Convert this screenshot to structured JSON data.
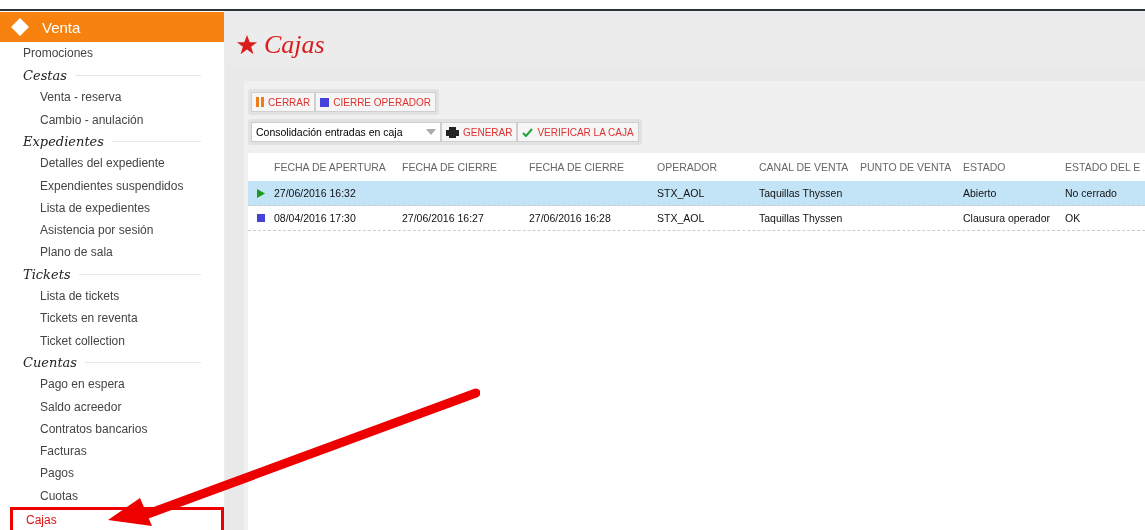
{
  "sidebar": {
    "header": "Venta",
    "items": [
      {
        "kind": "link",
        "label": "Promociones",
        "selected": false
      },
      {
        "kind": "section",
        "label": "Cestas",
        "children": [
          {
            "label": "Venta - reserva",
            "selected": false
          },
          {
            "label": "Cambio - anulación",
            "selected": false
          }
        ]
      },
      {
        "kind": "section",
        "label": "Expedientes",
        "children": [
          {
            "label": "Detalles del expediente",
            "selected": false
          },
          {
            "label": "Expendientes suspendidos",
            "selected": false
          },
          {
            "label": "Lista de expedientes",
            "selected": false
          },
          {
            "label": "Asistencia por sesión",
            "selected": false
          },
          {
            "label": "Plano de sala",
            "selected": false
          }
        ]
      },
      {
        "kind": "section",
        "label": "Tickets",
        "children": [
          {
            "label": "Lista de tickets",
            "selected": false
          },
          {
            "label": "Tickets en reventa",
            "selected": false
          },
          {
            "label": "Ticket collection",
            "selected": false
          }
        ]
      },
      {
        "kind": "section",
        "label": "Cuentas",
        "children": [
          {
            "label": "Pago en espera",
            "selected": false
          },
          {
            "label": "Saldo acreedor",
            "selected": false
          },
          {
            "label": "Contratos bancarios",
            "selected": false
          },
          {
            "label": "Facturas",
            "selected": false
          },
          {
            "label": "Pagos",
            "selected": false
          },
          {
            "label": "Cuotas",
            "selected": false
          }
        ]
      },
      {
        "kind": "link",
        "label": "Cajas",
        "selected": true
      }
    ]
  },
  "page": {
    "title": "Cajas"
  },
  "toolbar": {
    "buttons": [
      {
        "kind": "pause",
        "label": "CERRAR"
      },
      {
        "kind": "stop",
        "label": "CIERRE OPERADOR"
      }
    ]
  },
  "report_bar": {
    "select": {
      "value": "Consolidación entradas en caja"
    },
    "buttons": [
      {
        "kind": "print",
        "label": "GENERAR"
      },
      {
        "kind": "check",
        "label": "VERIFICAR LA CAJA"
      }
    ]
  },
  "table": {
    "columns": [
      "FECHA DE APERTURA",
      "FECHA DE CIERRE",
      "FECHA DE CIERRE",
      "OPERADOR",
      "CANAL DE VENTA",
      "PUNTO DE VENTA",
      "ESTADO",
      "ESTADO DEL E"
    ],
    "rows": [
      {
        "kind": "open",
        "selected": true,
        "cells": [
          "27/06/2016 16:32",
          "",
          "",
          "STX_AOL",
          "Taquillas Thyssen",
          "",
          "Abierto",
          "No cerrado"
        ]
      },
      {
        "kind": "closed",
        "selected": false,
        "cells": [
          "08/04/2016 17:30",
          "27/06/2016 16:27",
          "27/06/2016 16:28",
          "STX_AOL",
          "Taquillas Thyssen",
          "",
          "Clausura operador",
          "OK"
        ]
      }
    ]
  }
}
